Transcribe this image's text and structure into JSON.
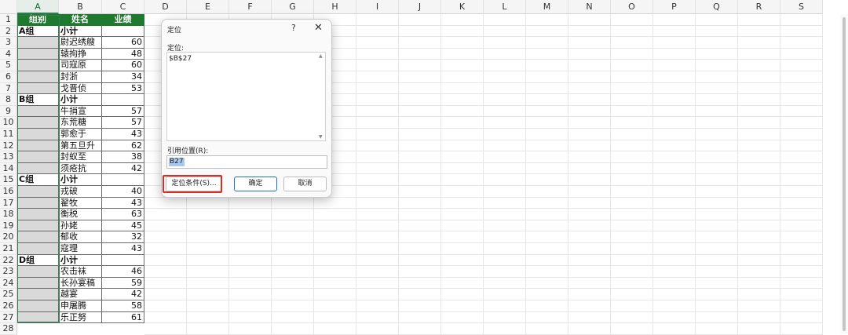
{
  "columns": [
    "A",
    "B",
    "C",
    "D",
    "E",
    "F",
    "G",
    "H",
    "I",
    "J",
    "K",
    "L",
    "M",
    "N",
    "O",
    "P",
    "Q",
    "R",
    "S"
  ],
  "row_numbers": [
    "1",
    "2",
    "3",
    "4",
    "5",
    "6",
    "7",
    "8",
    "9",
    "10",
    "11",
    "12",
    "13",
    "14",
    "15",
    "16",
    "17",
    "18",
    "19",
    "20",
    "21",
    "22",
    "23",
    "24",
    "25",
    "26",
    "27",
    "28"
  ],
  "table": {
    "headers": [
      "组别",
      "姓名",
      "业绩"
    ],
    "rows": [
      {
        "a": "A组",
        "b": "小计",
        "c": "",
        "type": "sub"
      },
      {
        "a": "",
        "b": "尉迟绣艘",
        "c": "60",
        "type": "d"
      },
      {
        "a": "",
        "b": "辕拘挣",
        "c": "48",
        "type": "d"
      },
      {
        "a": "",
        "b": "司寇原",
        "c": "60",
        "type": "d"
      },
      {
        "a": "",
        "b": "封浙",
        "c": "34",
        "type": "d"
      },
      {
        "a": "",
        "b": "戈晋侦",
        "c": "53",
        "type": "d"
      },
      {
        "a": "B组",
        "b": "小计",
        "c": "",
        "type": "sub"
      },
      {
        "a": "",
        "b": "牛捎宣",
        "c": "57",
        "type": "d"
      },
      {
        "a": "",
        "b": "东荒糖",
        "c": "57",
        "type": "d"
      },
      {
        "a": "",
        "b": "郭愈于",
        "c": "43",
        "type": "d"
      },
      {
        "a": "",
        "b": "第五旦升",
        "c": "62",
        "type": "d"
      },
      {
        "a": "",
        "b": "封蚁至",
        "c": "38",
        "type": "d"
      },
      {
        "a": "",
        "b": "须疮抗",
        "c": "42",
        "type": "d"
      },
      {
        "a": "C组",
        "b": "小计",
        "c": "",
        "type": "sub"
      },
      {
        "a": "",
        "b": "戎破",
        "c": "40",
        "type": "d"
      },
      {
        "a": "",
        "b": "翟牧",
        "c": "43",
        "type": "d"
      },
      {
        "a": "",
        "b": "衡税",
        "c": "63",
        "type": "d"
      },
      {
        "a": "",
        "b": "孙姥",
        "c": "45",
        "type": "d"
      },
      {
        "a": "",
        "b": "郁收",
        "c": "32",
        "type": "d"
      },
      {
        "a": "",
        "b": "寇理",
        "c": "43",
        "type": "d"
      },
      {
        "a": "D组",
        "b": "小计",
        "c": "",
        "type": "sub"
      },
      {
        "a": "",
        "b": "农击袜",
        "c": "46",
        "type": "d"
      },
      {
        "a": "",
        "b": "长孙宴稿",
        "c": "59",
        "type": "d"
      },
      {
        "a": "",
        "b": "越宴",
        "c": "42",
        "type": "d"
      },
      {
        "a": "",
        "b": "申屠腾",
        "c": "58",
        "type": "d"
      },
      {
        "a": "",
        "b": "乐正努",
        "c": "61",
        "type": "d"
      }
    ]
  },
  "dialog": {
    "title": "定位",
    "help": "?",
    "close": "✕",
    "goto_label": "定位:",
    "goto_item": "$B$27",
    "ref_label": "引用位置(R):",
    "ref_value": "B27",
    "btn_special": "定位条件(S)...",
    "btn_ok": "确定",
    "btn_cancel": "取消"
  },
  "colors": {
    "header_green": "#1f7a2f",
    "gray_fill": "#d9d9d9",
    "highlight_red": "#e02b20"
  }
}
